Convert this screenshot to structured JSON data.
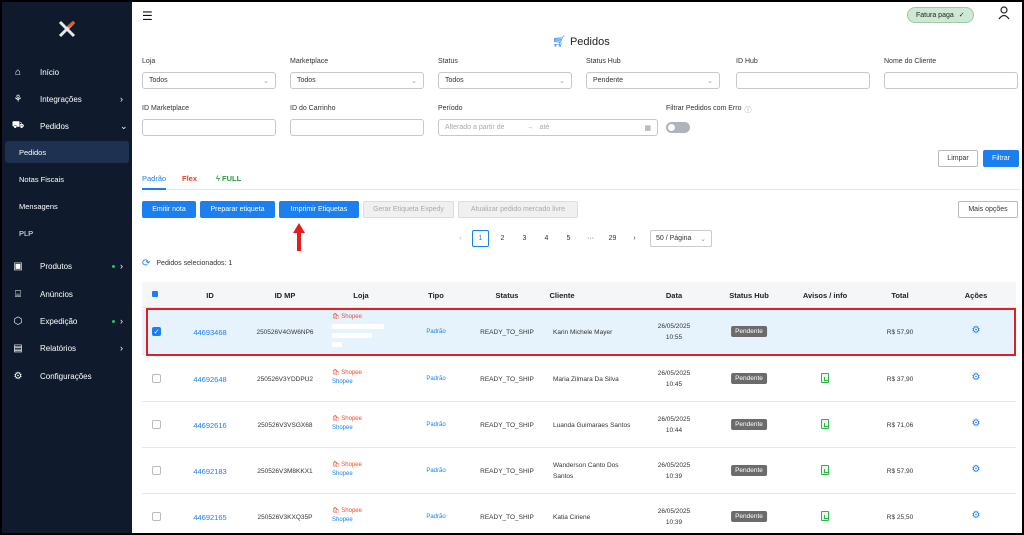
{
  "sidebar": {
    "items": [
      {
        "label": "Início",
        "icon": "home-icon"
      },
      {
        "label": "Integrações",
        "icon": "integrations-icon"
      },
      {
        "label": "Pedidos",
        "icon": "cart-icon"
      },
      {
        "label": "Produtos",
        "icon": "box-icon"
      },
      {
        "label": "Anúncios",
        "icon": "store-icon"
      },
      {
        "label": "Expedição",
        "icon": "package-icon"
      },
      {
        "label": "Relatórios",
        "icon": "report-icon"
      },
      {
        "label": "Configurações",
        "icon": "gear-icon"
      }
    ],
    "sub": [
      "Pedidos",
      "Notas Fiscais",
      "Mensagens",
      "PLP"
    ]
  },
  "header": {
    "fatura": "Fatura paga",
    "title": "Pedidos"
  },
  "filters": {
    "loja_label": "Loja",
    "loja_value": "Todos",
    "marketplace_label": "Marketplace",
    "marketplace_value": "Todos",
    "status_label": "Status",
    "status_value": "Todos",
    "status_hub_label": "Status Hub",
    "status_hub_value": "Pendente",
    "id_hub_label": "ID Hub",
    "nome_label": "Nome do Cliente",
    "id_mkt_label": "ID Marketplace",
    "carrinho_label": "ID do Carrinho",
    "periodo_label": "Período",
    "periodo_from": "Alterado a partir de",
    "periodo_to": "até",
    "erro_label": "Filtrar Pedidos com Erro"
  },
  "buttons": {
    "limpar": "Limpar",
    "filtrar": "Filtrar",
    "emitir": "Emitir nota",
    "preparar": "Preparar etiqueta",
    "imprimir": "Imprimir Etiquetas",
    "gerar": "Gerar Etiqueta Expedy",
    "atualizar": "Atualizar pedido mercado livre",
    "mais": "Mais opções"
  },
  "tabs": {
    "padrao": "Padrão",
    "flex": "Flex",
    "full": "FULL"
  },
  "pagination": {
    "pages": [
      "1",
      "2",
      "3",
      "4",
      "5",
      "29"
    ],
    "ellipsis": "···",
    "page_size": "50 / Página",
    "prev": "‹",
    "next": "›"
  },
  "selection": {
    "text": "Pedidos selecionados: 1"
  },
  "table": {
    "headers": [
      "ID",
      "ID MP",
      "Loja",
      "Tipo",
      "Status",
      "Cliente",
      "Data",
      "Status Hub",
      "Avisos / info",
      "Total",
      "Ações"
    ],
    "rows": [
      {
        "id": "44693468",
        "idmp": "250526V4GW6NP6",
        "loja": "Shopee",
        "tipo": "Padrão",
        "status": "READY_TO_SHIP",
        "cliente": "Karin Michele Mayer",
        "cliente2": "",
        "data": "26/05/2025",
        "hora": "10:55",
        "hub": "Pendente",
        "total": "R$ 57,90",
        "selected": true
      },
      {
        "id": "44692648",
        "idmp": "250526V3YDDPU2",
        "loja": "Shopee",
        "tipo": "Padrão",
        "status": "READY_TO_SHIP",
        "cliente": "Maria Zilmara Da Silva",
        "cliente2": "",
        "data": "26/05/2025",
        "hora": "10:45",
        "hub": "Pendente",
        "total": "R$ 37,90",
        "selected": false
      },
      {
        "id": "44692616",
        "idmp": "250526V3VSGX68",
        "loja": "Shopee",
        "tipo": "Padrão",
        "status": "READY_TO_SHIP",
        "cliente": "Luanda Guimaraes Santos",
        "cliente2": "",
        "data": "26/05/2025",
        "hora": "10:44",
        "hub": "Pendente",
        "total": "R$ 71,06",
        "selected": false
      },
      {
        "id": "44692183",
        "idmp": "250526V3M8KKX1",
        "loja": "Shopee",
        "tipo": "Padrão",
        "status": "READY_TO_SHIP",
        "cliente": "Wanderson Canto Dos",
        "cliente2": "Santos",
        "data": "26/05/2025",
        "hora": "10:39",
        "hub": "Pendente",
        "total": "R$ 57,90",
        "selected": false
      },
      {
        "id": "44692165",
        "idmp": "250526V3KXQ35P",
        "loja": "Shopee",
        "tipo": "Padrão",
        "status": "READY_TO_SHIP",
        "cliente": "Katia Ciriene",
        "cliente2": "",
        "data": "26/05/2025",
        "hora": "10:39",
        "hub": "Pendente",
        "total": "R$ 25,50",
        "selected": false
      }
    ]
  }
}
